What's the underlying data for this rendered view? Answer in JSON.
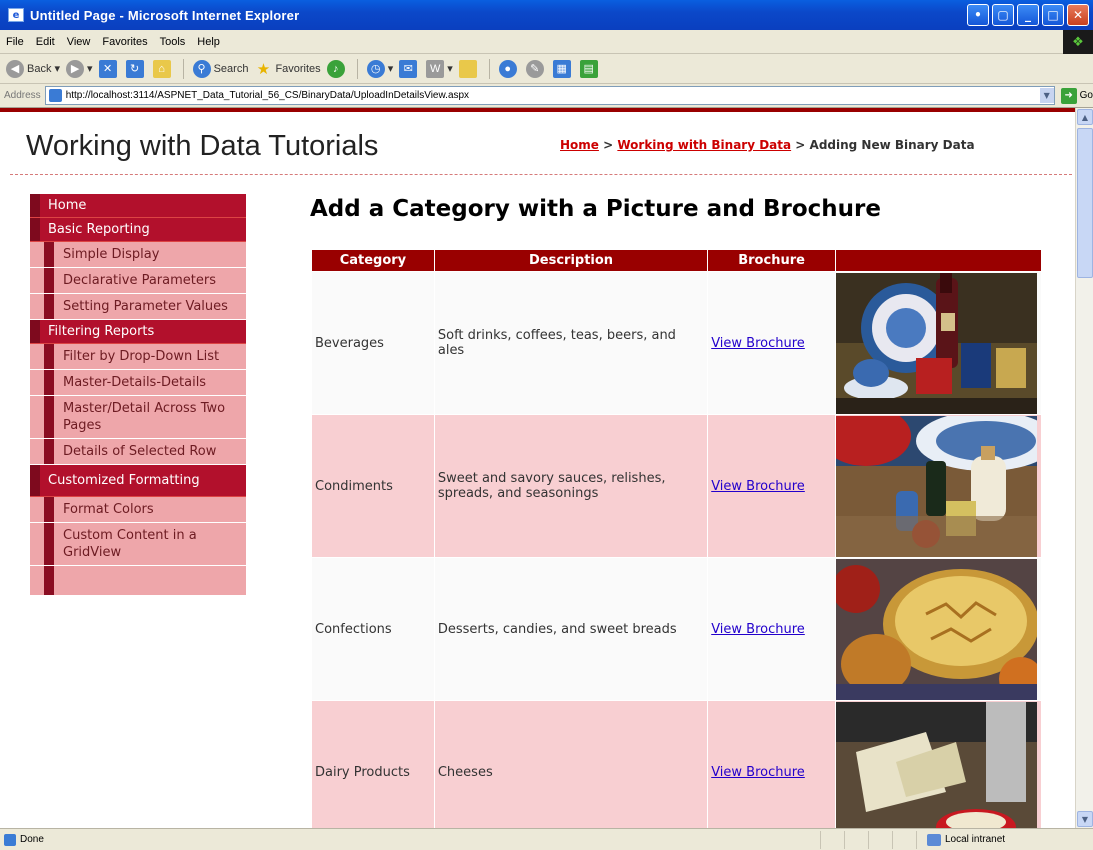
{
  "window": {
    "title": "Untitled Page - Microsoft Internet Explorer",
    "app_icon": "ie-page-icon"
  },
  "menu": [
    "File",
    "Edit",
    "View",
    "Favorites",
    "Tools",
    "Help"
  ],
  "toolbar": {
    "back": "Back",
    "search": "Search",
    "favorites": "Favorites"
  },
  "address": {
    "label": "Address",
    "url": "http://localhost:3114/ASPNET_Data_Tutorial_56_CS/BinaryData/UploadInDetailsView.aspx",
    "go": "Go"
  },
  "site": {
    "title": "Working with Data Tutorials",
    "breadcrumb": {
      "home": "Home",
      "sep1": " > ",
      "binary": "Working with Binary Data",
      "sep2": " > ",
      "current": "Adding New Binary Data"
    }
  },
  "sidebar": {
    "sections": [
      {
        "label": "Home",
        "items": []
      },
      {
        "label": "Basic Reporting",
        "items": [
          "Simple Display",
          "Declarative Parameters",
          "Setting Parameter Values"
        ]
      },
      {
        "label": "Filtering Reports",
        "items": [
          "Filter by Drop-Down List",
          "Master-Details-Details",
          "Master/Detail Across Two Pages",
          "Details of Selected Row"
        ]
      },
      {
        "label": "Customized Formatting",
        "items": [
          "Format Colors",
          "Custom Content in a GridView"
        ]
      }
    ]
  },
  "main": {
    "heading": "Add a Category with a Picture and Brochure",
    "columns": [
      "Category",
      "Description",
      "Brochure",
      ""
    ],
    "rows": [
      {
        "category": "Beverages",
        "description": "Soft drinks, coffees, teas, beers, and ales",
        "brochure": "View Brochure"
      },
      {
        "category": "Condiments",
        "description": "Sweet and savory sauces, relishes, spreads, and seasonings",
        "brochure": "View Brochure"
      },
      {
        "category": "Confections",
        "description": "Desserts, candies, and sweet breads",
        "brochure": "View Brochure"
      },
      {
        "category": "Dairy Products",
        "description": "Cheeses",
        "brochure": "View Brochure"
      }
    ]
  },
  "status": {
    "text": "Done",
    "zone": "Local intranet"
  },
  "colors": {
    "header_red": "#990000",
    "sidebar_section": "#b2102c",
    "sidebar_item": "#eea6aa",
    "alt_row": "#f8cfd2",
    "link": "#2200cc"
  }
}
